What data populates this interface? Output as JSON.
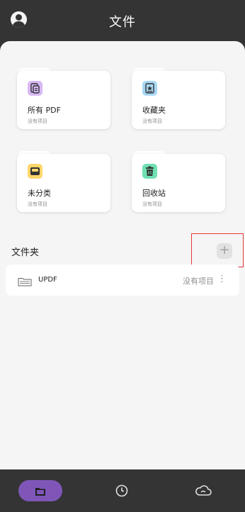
{
  "header": {
    "title": "文件",
    "avatar_icon": "user-avatar-icon"
  },
  "categories": [
    {
      "label": "所有 PDF",
      "sub": "没有项目",
      "icon": "all-pdf-icon",
      "color": "#d7b8f5"
    },
    {
      "label": "收藏夹",
      "sub": "没有项目",
      "icon": "favorites-star-icon",
      "color": "#a8d8f5"
    },
    {
      "label": "未分类",
      "sub": "没有项目",
      "icon": "inbox-tray-icon",
      "color": "#ffd66b"
    },
    {
      "label": "回收站",
      "sub": "没有项目",
      "icon": "trash-icon",
      "color": "#6fe0b3"
    }
  ],
  "folders_section": {
    "title": "文件夹",
    "add_symbol": "+",
    "items": [
      {
        "name": "UPDF",
        "count": "没有项目",
        "more": "⋮"
      }
    ]
  },
  "bottom_nav": [
    {
      "icon": "folder-icon",
      "active": true,
      "color": "#7f56b8"
    },
    {
      "icon": "clock-icon",
      "active": false
    },
    {
      "icon": "cloud-icon",
      "active": false
    }
  ]
}
